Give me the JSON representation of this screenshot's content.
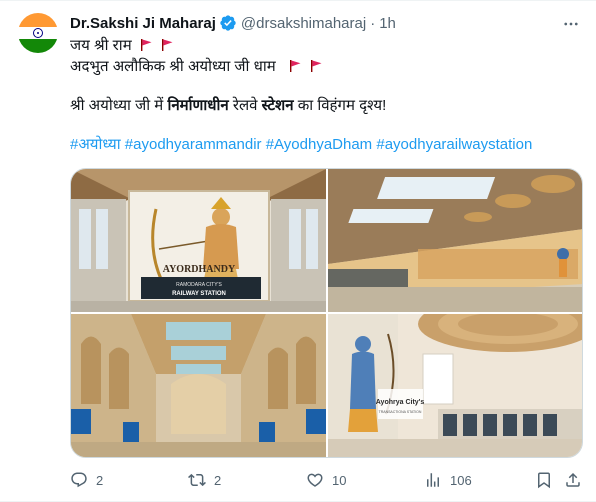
{
  "tweet": {
    "author": {
      "name": "Dr.Sakshi Ji Maharaj",
      "handle": "@drsakshimaharaj",
      "separator": "·",
      "time": "1h",
      "avatar_icon": "india-flag-avatar",
      "verified_icon": "verified-badge-icon",
      "verified_color": "#1d9bf0"
    },
    "more_icon": "more-options-icon",
    "lines": {
      "line1": "जय श्री राम",
      "line2": "अदभुत अलौकिक श्री अयोध्या जी धाम",
      "line3_part1": "श्री अयोध्या जी में ",
      "line3_bold1": "निर्माणाधीन",
      "line3_part2": " रेलवे ",
      "line3_bold2": "स्टेशन",
      "line3_part3": " का विहंगम दृश्य!"
    },
    "hashtags": [
      "#अयोध्या",
      "#ayodhyarammandir",
      "#AyodhyaDham",
      "#ayodhyarailwaystation"
    ],
    "hashtag_color": "#1d9bf0",
    "media": {
      "image1": {
        "sign_title": "AYORDHANDY",
        "sign_sub": "RAMODARA CITY'S",
        "sign_main": "RAILWAY STATION"
      },
      "image4": {
        "sign_title": "Ayohrya City's",
        "sign_sub": "TRANSACTIONA STATION"
      }
    },
    "actions": {
      "reply_count": "2",
      "retweet_count": "2",
      "like_count": "10",
      "views_count": "106",
      "reply_icon": "reply-icon",
      "retweet_icon": "retweet-icon",
      "like_icon": "heart-icon",
      "views_icon": "views-chart-icon",
      "bookmark_icon": "bookmark-icon",
      "share_icon": "share-icon"
    }
  }
}
